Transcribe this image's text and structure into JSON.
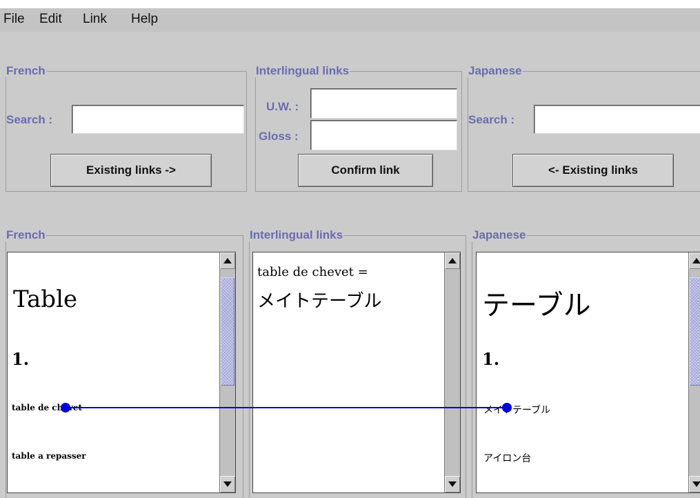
{
  "menu": {
    "file": "File",
    "edit": "Edit",
    "link": "Link",
    "help": "Help"
  },
  "search_section": {
    "french": {
      "legend": "French",
      "search_label": "Search :",
      "search_value": "",
      "button": "Existing links ->"
    },
    "interlingual": {
      "legend": "Interlingual links",
      "uw_label": "U.W. :",
      "uw_value": "",
      "gloss_label": "Gloss :",
      "gloss_value": "",
      "button": "Confirm link"
    },
    "japanese": {
      "legend": "Japanese",
      "search_label": "Search :",
      "search_value": "",
      "button": "<- Existing links"
    }
  },
  "display_section": {
    "french": {
      "legend": "French",
      "headword": "Table",
      "sense_number": "1.",
      "entries": [
        "table de chevet",
        "table a repasser"
      ]
    },
    "interlingual": {
      "legend": "Interlingual links",
      "link_line1": "table de chevet =",
      "link_line2": "メイトテーブル"
    },
    "japanese": {
      "legend": "Japanese",
      "headword": "テーブル",
      "sense_number": "1.",
      "entries": [
        "メイトテーブル",
        "アイロン台"
      ]
    }
  },
  "link_line": {
    "color": "#0000e0",
    "from": "table de chevet",
    "to": "メイトテーブル"
  }
}
